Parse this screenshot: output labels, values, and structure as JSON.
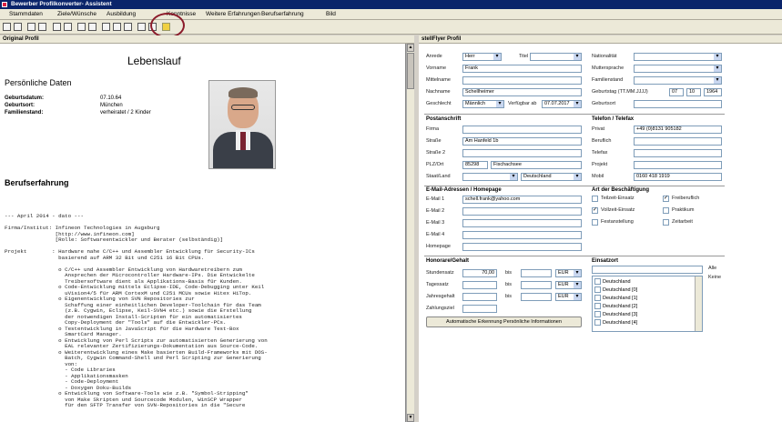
{
  "window": {
    "title": "Bewerber Profilkonverter- Assistent"
  },
  "menu": [
    "Stammdaten",
    "Ziele/Wünsche",
    "Ausbildung",
    "Kenntnisse",
    "Weitere Erfahrungen",
    "Berufserfahrung",
    "Bild"
  ],
  "panels": {
    "left_title": "Original Profil",
    "right_title": "stellFlyer Profil"
  },
  "cv": {
    "title": "Lebenslauf",
    "section_personal": "Persönliche Daten",
    "birth_label": "Geburtsdatum:",
    "birth_value": "07.10.64",
    "birthplace_label": "Geburtsort:",
    "birthplace_value": "München",
    "marital_label": "Familienstand:",
    "marital_value": "verheiratet / 2 Kinder",
    "section_experience": "Berufserfahrung",
    "text": "--- April 2014 - dato ---\n\nFirma/Institut: Infineon Technologies in Augsburg\n                [http://www.infineon.com]\n                [Rolle: Softwareentwickler und Berater (selbständig)]\n\nProjekt        : Hardware nahe C/C++ und Assembler Entwicklung für Security-ICs\n                 basierend auf ARM 32 Bit und C251 16 Bit CPUs.\n\n                 o C/C++ und Assembler Entwicklung von Hardwaretreibern zum\n                   Ansprechen der Microcontroller Hardware-IPs. Die Entwickelte\n                   Treibersoftware dient als Applikations-Basis für Kunden.\n                 o Code-Entwicklung mittels Eclipse-IDE, Code-Debugging unter Keil\n                   uVision4/5 für ARM CortexM und C251 MCUs sowie Hitex HiTop.\n                 o Eigenentwicklung von SVN Repositories zur\n                   Schaffung einer einheitlichen Developer-Toolchain für das Team\n                   (z.B. Cygwin, Eclipse, Keil-SVN4 etc.) sowie die Erstellung\n                   der notwendigen Install-Scripten für ein automatisiertes\n                   Copy-Deployment der \"Tools\" auf die Entwickler-PCs.\n                 o Testentwicklung in JavaScript für die Hardware Test-Box\n                   SmartCard Manager.\n                 o Entwicklung von Perl Scripts zur automatisierten Generierung von\n                   EAL relevanter Zertifizierungs-Dokumentation aus Source-Code.\n                 o Weiterentwicklung eines Make basierten Build-Frameworks mit DOS-\n                   Batch, Cygwin Command-Shell und Perl Scripting zur Generierung\n                   von:\n                   - Code Libraries\n                   - Applikationsmasken\n                   - Code-Deployment\n                   - Doxygen Doku-Builds\n                 o Entwicklung von Software-Tools wie z.B. \"Symbol-Stripping\"\n                   von Make Skripten und Sourcecode Modulen, WinSCP Wrapper\n                   für den SFTP Transfer von SVN-Repositories in die \"Secure"
  },
  "form": {
    "anrede_label": "Anrede",
    "anrede_value": "Herr",
    "titel_label": "Titel",
    "titel_value": "",
    "vorname_label": "Vorname",
    "vorname_value": "Frank",
    "mittelname_label": "Mittelname",
    "mittelname_value": "",
    "nachname_label": "Nachname",
    "nachname_value": "Schellheimer",
    "geschlecht_label": "Geschlecht",
    "geschlecht_value": "Männlich",
    "verfuegbar_label": "Verfügbar ab",
    "verfuegbar_value": "07.07.2017",
    "nation_label": "Nationalität",
    "mutter_label": "Muttersprache",
    "familie_label": "Familienstand",
    "geburtstag_label": "Geburtstag (TT.MM.JJJJ)",
    "geb_tt": "07",
    "geb_mm": "10",
    "geb_jjjj": "1964",
    "geburtsort_label": "Geburtsort",
    "geburtsort_value": "",
    "postanschrift": "Postanschrift",
    "firma_label": "Firma",
    "strasse_label": "Straße",
    "strasse_value": "Am Hanfeld 1b",
    "strasse2_label": "Straße 2",
    "plz_label": "PLZ/Ort",
    "plz_value": "85298",
    "ort_value": "Fischachsee",
    "staat_label": "Staat/Land",
    "land_value": "Deutschland",
    "telefon_header": "Telefon / Telefax",
    "privat_label": "Privat",
    "privat_value": "+49 (0)8131 905182",
    "beruf_label": "Beruflich",
    "telefax_label": "Telefax",
    "projekt_label": "Projekt",
    "mobil_label": "Mobil",
    "mobil_value": "0160 418 1919",
    "email_header": "E-Mail-Adressen / Homepage",
    "email1_label": "E-Mail 1",
    "email1_value": "schell.frank@yahoo.com",
    "email2_label": "E-Mail 2",
    "email3_label": "E-Mail 3",
    "email4_label": "E-Mail 4",
    "homepage_label": "Homepage",
    "art_header": "Art der Beschäftigung",
    "teilzeit": "Teilzeit-Einsatz",
    "freiberuflich": "Freiberuflich",
    "vollzeit": "Vollzeit-Einsatz",
    "praktikum": "Praktikum",
    "festanstellung": "Festanstellung",
    "zeitarbeit": "Zeitarbeit",
    "honorare_header": "Honorare/Gehalt",
    "stunden_label": "Stundensatz",
    "stunden_value": "70,00",
    "bis": "bis",
    "eur": "EUR",
    "tages_label": "Tagessatz",
    "jahres_label": "Jahresgehalt",
    "zahlung_label": "Zahlungsziel",
    "auto_button": "Automatische Erkennung Persönliche Informationen",
    "einsatz_header": "Einsatzort",
    "alle": "Alle",
    "keine": "Keine",
    "einsatz_list": [
      "Deutschland",
      "Deutschland [0]",
      "Deutschland [1]",
      "Deutschland [2]",
      "Deutschland [3]",
      "Deutschland [4]"
    ]
  }
}
